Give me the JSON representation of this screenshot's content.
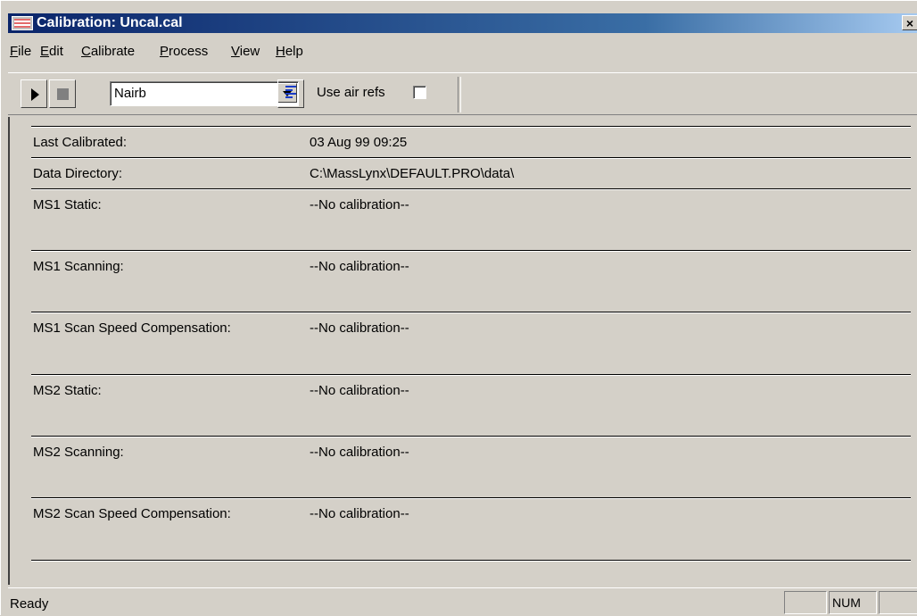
{
  "window": {
    "title": "Calibration: Uncal.cal",
    "close_glyph": "×"
  },
  "menu": {
    "items": [
      {
        "label": "File",
        "accel": "F",
        "rest": "ile"
      },
      {
        "label": "Edit",
        "accel": "E",
        "rest": "dit"
      },
      {
        "label": "Calibrate",
        "accel": "C",
        "rest": "alibrate"
      },
      {
        "label": "Process",
        "accel": "P",
        "rest": "rocess"
      },
      {
        "label": "View",
        "accel": "V",
        "rest": "iew"
      },
      {
        "label": "Help",
        "accel": "H",
        "rest": "elp"
      }
    ]
  },
  "toolbar": {
    "reference_select": "Nairb",
    "use_air_refs_label": "Use air refs",
    "use_air_refs_checked": false,
    "icons": [
      "play-icon",
      "stop-icon",
      "dropdown-arrow-icon",
      "list-icon"
    ]
  },
  "details": {
    "rows": [
      {
        "label": "Last Calibrated:",
        "value": "03 Aug 99 09:25"
      },
      {
        "label": "Data Directory:",
        "value": "C:\\MassLynx\\DEFAULT.PRO\\data\\"
      },
      {
        "label": "MS1 Static:",
        "value": "--No calibration--"
      },
      {
        "label": "MS1 Scanning:",
        "value": "--No calibration--"
      },
      {
        "label": "MS1 Scan Speed Compensation:",
        "value": "--No calibration--"
      },
      {
        "label": "MS2 Static:",
        "value": "--No calibration--"
      },
      {
        "label": "MS2 Scanning:",
        "value": "--No calibration--"
      },
      {
        "label": "MS2 Scan Speed Compensation:",
        "value": "--No calibration--"
      }
    ]
  },
  "status": {
    "text": "Ready",
    "panels": [
      "",
      "NUM",
      ""
    ]
  }
}
